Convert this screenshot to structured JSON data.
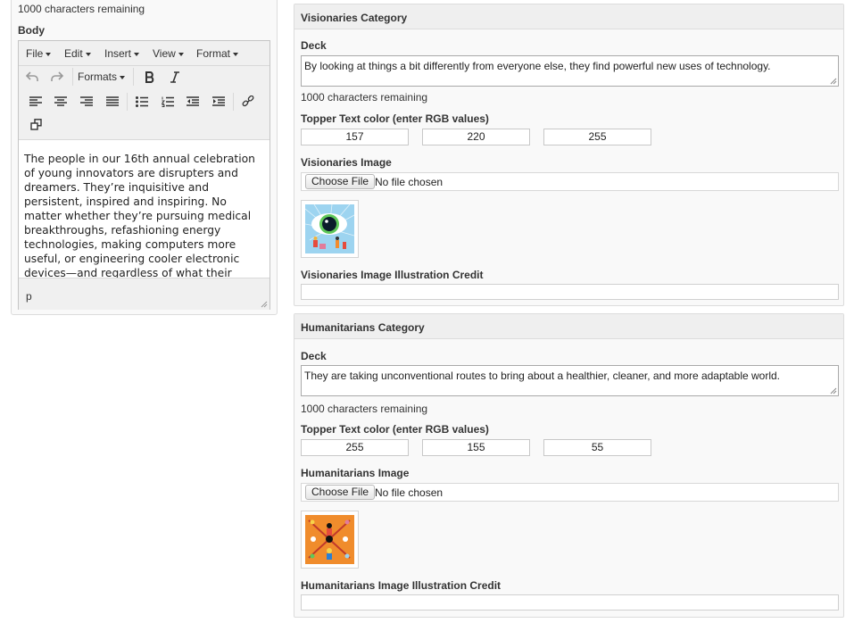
{
  "body_section": {
    "chars_remaining": "1000 characters remaining",
    "body_label": "Body",
    "menu": [
      "File",
      "Edit",
      "Insert",
      "View",
      "Format"
    ],
    "formats_label": "Formats",
    "content": "The people in our 16th annual celebration of young innovators are disrupters and dreamers. They’re inquisitive and persistent, inspired and inspiring. No matter whether they’re pursuing medical breakthroughs, refashioning energy technologies, making computers more useful, or engineering cooler electronic devices—and regardless of what their motivations are, what unites them is their ingenuity",
    "status_path": "p"
  },
  "visionaries": {
    "title": "Visionaries Category",
    "deck_label": "Deck",
    "deck_value": "By looking at things a bit differently from everyone else, they find powerful new uses of technology.",
    "chars_remaining": "1000 characters remaining",
    "color_label": "Topper Text color (enter RGB values)",
    "rgb": [
      "157",
      "220",
      "255"
    ],
    "image_label": "Visionaries Image",
    "choose_file": "Choose File",
    "no_file": "No file chosen",
    "credit_label": "Visionaries Image Illustration Credit",
    "credit_value": ""
  },
  "humanitarians": {
    "title": "Humanitarians Category",
    "deck_label": "Deck",
    "deck_value": "They are taking unconventional routes to bring about a healthier, cleaner, and more adaptable world.",
    "chars_remaining": "1000 characters remaining",
    "color_label": "Topper Text color (enter RGB values)",
    "rgb": [
      "255",
      "155",
      "55"
    ],
    "image_label": "Humanitarians Image",
    "choose_file": "Choose File",
    "no_file": "No file chosen",
    "credit_label": "Humanitarians Image Illustration Credit",
    "credit_value": ""
  },
  "colors": {
    "visionaries_thumb_bg": "#9dd4f0",
    "humanitarians_thumb_bg": "#f08c2c"
  }
}
